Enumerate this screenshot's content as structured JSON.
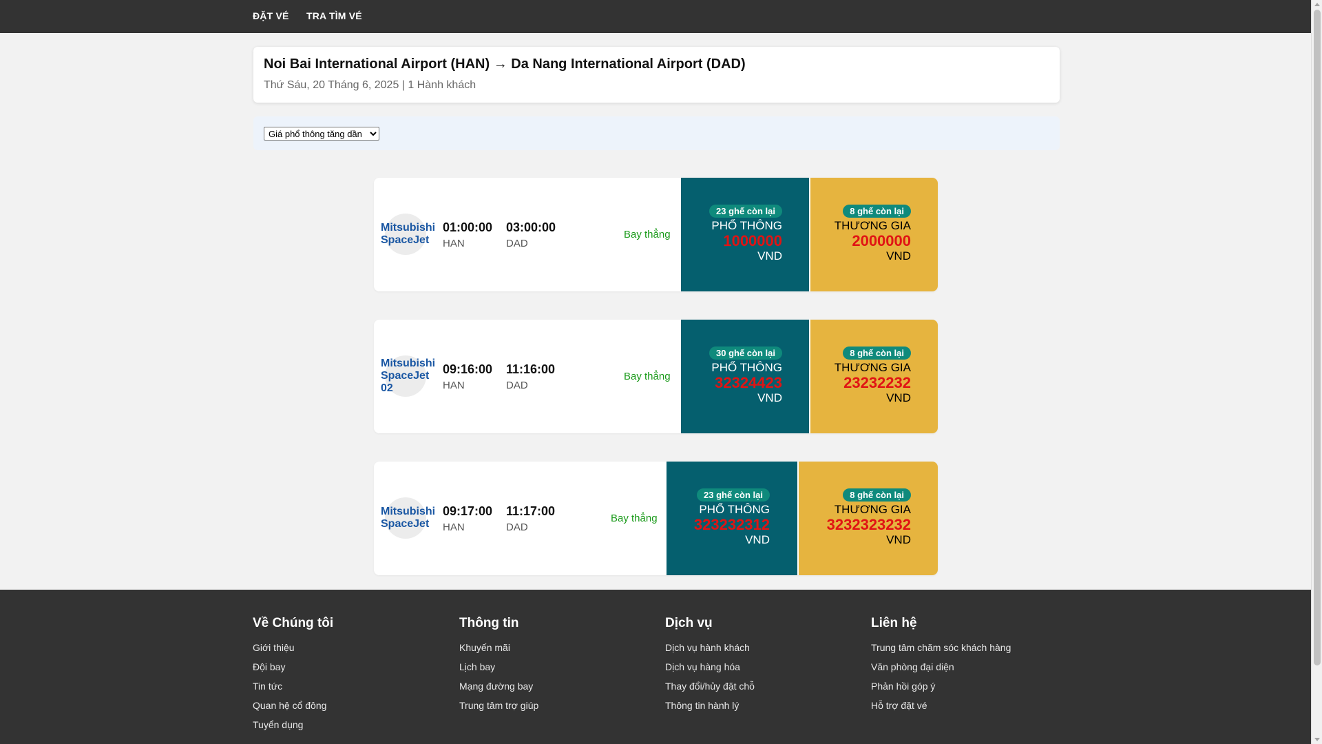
{
  "nav": {
    "items": [
      "ĐẶT VÉ",
      "TRA TÌM VÉ"
    ]
  },
  "route": {
    "title": "Noi Bai International Airport (HAN) → Da Nang International Airport (DAD)",
    "subtitle": "Thứ Sáu, 20 Tháng 6, 2025 | 1 Hành khách"
  },
  "sort": {
    "selected": "Giá phổ thông tăng dần"
  },
  "flights": [
    {
      "airline": "Mitsubishi SpaceJet",
      "depart_time": "01:00:00",
      "depart_airport": "HAN",
      "arrive_time": "03:00:00",
      "arrive_airport": "DAD",
      "stops": "Bay thẳng",
      "economy": {
        "seats": "23 ghế còn lại",
        "class": "PHỔ THÔNG",
        "price": "1000000",
        "currency": "VND"
      },
      "business": {
        "seats": "8 ghế còn lại",
        "class": "THƯƠNG GIA",
        "price": "2000000",
        "currency": "VND"
      }
    },
    {
      "airline": "Mitsubishi SpaceJet 02",
      "depart_time": "09:16:00",
      "depart_airport": "HAN",
      "arrive_time": "11:16:00",
      "arrive_airport": "DAD",
      "stops": "Bay thẳng",
      "economy": {
        "seats": "30 ghế còn lại",
        "class": "PHỔ THÔNG",
        "price": "32324423",
        "currency": "VND"
      },
      "business": {
        "seats": "8 ghế còn lại",
        "class": "THƯƠNG GIA",
        "price": "23232232",
        "currency": "VND"
      }
    },
    {
      "airline": "Mitsubishi SpaceJet",
      "depart_time": "09:17:00",
      "depart_airport": "HAN",
      "arrive_time": "11:17:00",
      "arrive_airport": "DAD",
      "stops": "Bay thẳng",
      "economy": {
        "seats": "23 ghế còn lại",
        "class": "PHỔ THÔNG",
        "price": "323232312",
        "currency": "VND"
      },
      "business": {
        "seats": "8 ghế còn lại",
        "class": "THƯƠNG GIA",
        "price": "3232323232",
        "currency": "VND"
      }
    }
  ],
  "footer": {
    "columns": [
      {
        "heading": "Về Chúng tôi",
        "links": [
          "Giới thiệu",
          "Đội bay",
          "Tin tức",
          "Quan hệ cổ đông",
          "Tuyển dụng"
        ]
      },
      {
        "heading": "Thông tin",
        "links": [
          "Khuyến mãi",
          "Lịch bay",
          "Mạng đường bay",
          "Trung tâm trợ giúp"
        ]
      },
      {
        "heading": "Dịch vụ",
        "links": [
          "Dịch vụ hành khách",
          "Dịch vụ hàng hóa",
          "Thay đổi/hủy đặt chỗ",
          "Thông tin hành lý"
        ]
      },
      {
        "heading": "Liên hệ",
        "links": [
          "Trung tâm chăm sóc khách hàng",
          "Văn phòng đại diện",
          "Phản hồi góp ý",
          "Hỗ trợ đặt vé"
        ]
      }
    ]
  },
  "colors": {
    "nav_bg": "#333333",
    "economy_bg": "#055f6e",
    "business_bg": "#e6b43f",
    "price_red": "#e01414",
    "airline_blue": "#1a57a3",
    "direct_green": "#1a9a1a"
  }
}
